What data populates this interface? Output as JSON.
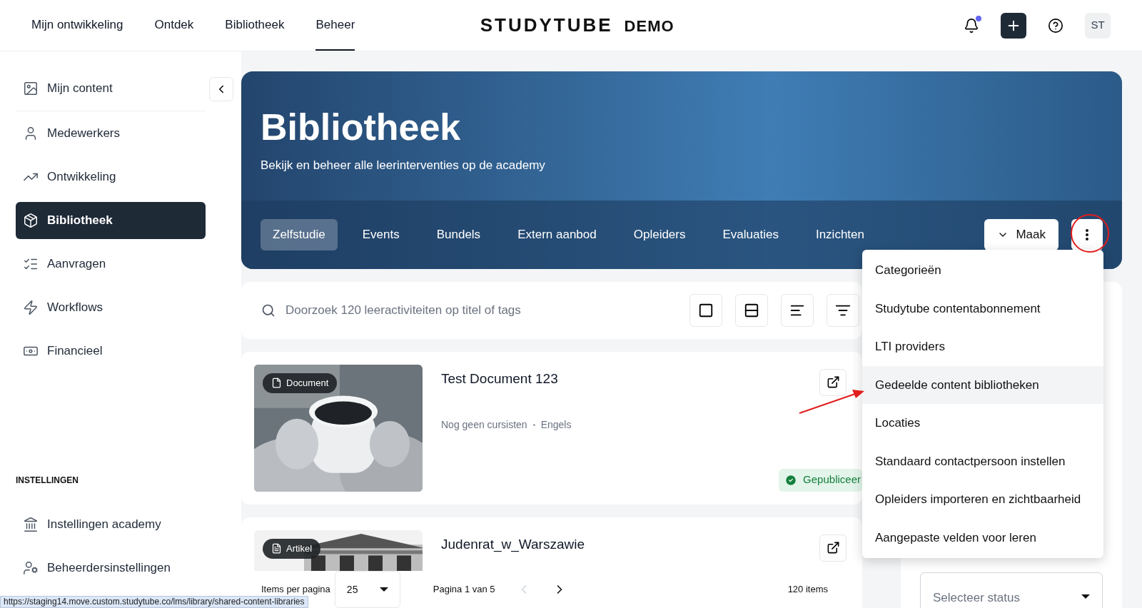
{
  "top_nav": [
    {
      "label": "Mijn ontwikkeling",
      "selected": false
    },
    {
      "label": "Ontdek",
      "selected": false
    },
    {
      "label": "Bibliotheek",
      "selected": false
    },
    {
      "label": "Beheer",
      "selected": true
    }
  ],
  "logo": {
    "name": "STUDYTUBE",
    "suffix": "DEMO"
  },
  "user": {
    "initials": "ST"
  },
  "sidebar": {
    "items": [
      {
        "label": "Mijn content",
        "selected": false
      },
      {
        "label": "Medewerkers",
        "selected": false
      },
      {
        "label": "Ontwikkeling",
        "selected": false
      },
      {
        "label": "Bibliotheek",
        "selected": true
      },
      {
        "label": "Aanvragen",
        "selected": false
      },
      {
        "label": "Workflows",
        "selected": false
      },
      {
        "label": "Financieel",
        "selected": false
      }
    ],
    "settings_heading": "INSTELLINGEN",
    "settings_items": [
      {
        "label": "Instellingen academy",
        "selected": false
      },
      {
        "label": "Beheerdersinstellingen",
        "selected": false
      }
    ]
  },
  "hero": {
    "title": "Bibliotheek",
    "subtitle": "Bekijk en beheer alle leerinterventies op de academy",
    "tabs": [
      {
        "label": "Zelfstudie",
        "selected": true
      },
      {
        "label": "Events",
        "selected": false
      },
      {
        "label": "Bundels",
        "selected": false
      },
      {
        "label": "Extern aanbod",
        "selected": false
      },
      {
        "label": "Opleiders",
        "selected": false
      },
      {
        "label": "Evaluaties",
        "selected": false
      },
      {
        "label": "Inzichten",
        "selected": false
      }
    ],
    "create_button": "Maak"
  },
  "more_menu": [
    {
      "label": "Categorieën",
      "highlighted": false
    },
    {
      "label": "Studytube contentabonnement",
      "highlighted": false
    },
    {
      "label": "LTI providers",
      "highlighted": false
    },
    {
      "label": "Gedeelde content bibliotheken",
      "highlighted": true
    },
    {
      "label": "Locaties",
      "highlighted": false
    },
    {
      "label": "Standaard contactpersoon instellen",
      "highlighted": false
    },
    {
      "label": "Opleiders importeren en zichtbaarheid",
      "highlighted": false
    },
    {
      "label": "Aangepaste velden voor leren",
      "highlighted": false
    }
  ],
  "search": {
    "placeholder": "Doorzoek 120 leeractiviteiten op titel of tags"
  },
  "items": [
    {
      "type_label": "Document",
      "kind": "document",
      "title": "Test Document 123",
      "meta": [
        "Nog geen cursisten",
        "Engels"
      ],
      "status": "Gepubliceer"
    },
    {
      "type_label": "Artikel",
      "kind": "article",
      "title": "Judenrat_w_Warszawie"
    }
  ],
  "pagination": {
    "per_page_label": "Items per pagina",
    "per_page": "25",
    "page": "Pagina 1 van 5",
    "prev_disabled": true,
    "total": "120 items"
  },
  "status_filter": {
    "placeholder": "Selecteer status"
  },
  "status_url": "https://staging14.move.custom.studytube.co/lms/library/shared-content-libraries"
}
